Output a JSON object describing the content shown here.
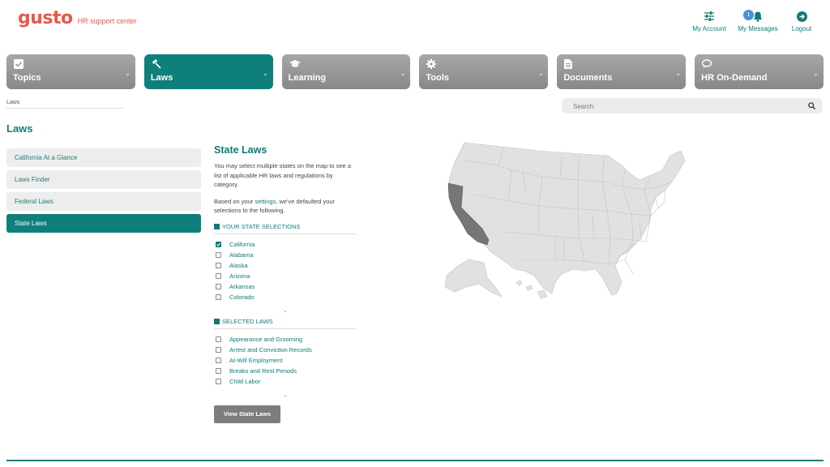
{
  "header": {
    "logo": "gusto",
    "tagline": "HR support center",
    "actions": [
      {
        "label": "My Account",
        "icon": "sliders-icon"
      },
      {
        "label": "My Messages",
        "icon": "bell-icon",
        "badge": "1"
      },
      {
        "label": "Logout",
        "icon": "logout-arrow-icon"
      }
    ]
  },
  "nav": [
    {
      "label": "Topics",
      "icon": "check-square-icon",
      "active": false
    },
    {
      "label": "Laws",
      "icon": "gavel-icon",
      "active": true
    },
    {
      "label": "Learning",
      "icon": "graduation-cap-icon",
      "active": false
    },
    {
      "label": "Tools",
      "icon": "gear-icon",
      "active": false
    },
    {
      "label": "Documents",
      "icon": "document-icon",
      "active": false
    },
    {
      "label": "HR On-Demand",
      "icon": "chat-bubbles-icon",
      "active": false
    }
  ],
  "breadcrumb": "Laws",
  "search": {
    "placeholder": "Search"
  },
  "page_title": "Laws",
  "side_menu": [
    {
      "label": "California At a Glance",
      "active": false
    },
    {
      "label": "Laws Finder",
      "active": false
    },
    {
      "label": "Federal Laws",
      "active": false
    },
    {
      "label": "State Laws",
      "active": true
    }
  ],
  "content": {
    "title": "State Laws",
    "intro": "You may select multiple states on the map to see a list of applicable HR laws and regulations by category.",
    "defaults_prefix": "Based on your ",
    "defaults_link": "settings",
    "defaults_suffix": ", we've defaulted your selections to the following.",
    "state_section": "YOUR STATE SELECTIONS",
    "states": [
      {
        "label": "California",
        "checked": true
      },
      {
        "label": "Alabama",
        "checked": false
      },
      {
        "label": "Alaska",
        "checked": false
      },
      {
        "label": "Arizona",
        "checked": false
      },
      {
        "label": "Arkansas",
        "checked": false
      },
      {
        "label": "Colorado",
        "checked": false
      }
    ],
    "laws_section": "SELECTED LAWS",
    "laws": [
      {
        "label": "Appearance and Grooming",
        "checked": false
      },
      {
        "label": "Arrest and Conviction Records",
        "checked": false
      },
      {
        "label": "At-Will Employment",
        "checked": false
      },
      {
        "label": "Breaks and Rest Periods",
        "checked": false
      },
      {
        "label": "Child Labor",
        "checked": false
      }
    ],
    "button": "View State Laws"
  },
  "map": {
    "highlighted_state": "California",
    "highlight_color": "#767676",
    "base_color": "#e1e1e1"
  }
}
